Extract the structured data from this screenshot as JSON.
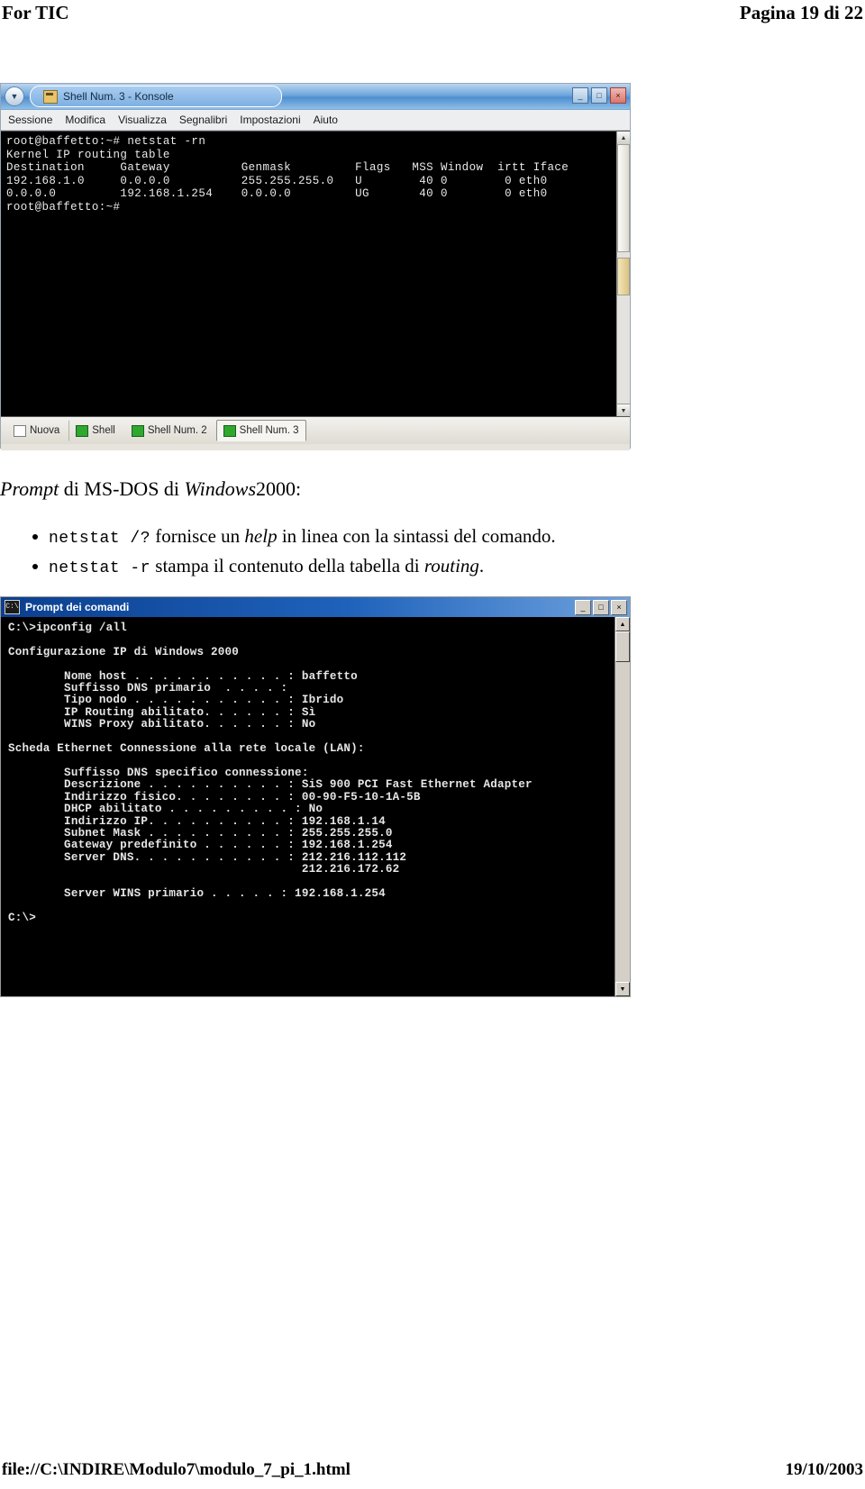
{
  "page": {
    "header_left": "For TIC",
    "header_right": "Pagina 19 di 22",
    "footer_left": "file://C:\\INDIRE\\Modulo7\\modulo_7_pi_1.html",
    "footer_right": "19/10/2003"
  },
  "konsole": {
    "title": "Shell Num. 3 - Konsole",
    "menu": [
      "Sessione",
      "Modifica",
      "Visualizza",
      "Segnalibri",
      "Impostazioni",
      "Aiuto"
    ],
    "window_buttons": [
      "_",
      "□",
      "×"
    ],
    "terminal_text": "root@baffetto:~# netstat -rn\nKernel IP routing table\nDestination     Gateway          Genmask         Flags   MSS Window  irtt Iface\n192.168.1.0     0.0.0.0          255.255.255.0   U        40 0        0 eth0\n0.0.0.0         192.168.1.254    0.0.0.0         UG       40 0        0 eth0\nroot@baffetto:~# ",
    "tabs": [
      {
        "label": "Nuova",
        "icon": "new-document-icon",
        "active": false
      },
      {
        "label": "Shell",
        "icon": "terminal-icon",
        "active": false
      },
      {
        "label": "Shell Num. 2",
        "icon": "terminal-icon",
        "active": false
      },
      {
        "label": "Shell Num. 3",
        "icon": "terminal-icon",
        "active": true
      }
    ]
  },
  "prose": {
    "lead_prompt": "Prompt",
    "lead_mid": " di MS-DOS di ",
    "lead_windows": "Windows",
    "lead_tail": "2000:",
    "bullet1_cmd": "netstat /?",
    "bullet1_a": " fornisce un ",
    "bullet1_help": "help",
    "bullet1_b": " in linea con la sintassi del comando.",
    "bullet2_cmd": "netstat -r",
    "bullet2_a": " stampa il contenuto della tabella di ",
    "bullet2_routing": "routing",
    "bullet2_b": "."
  },
  "cmdprompt": {
    "title": "Prompt dei comandi",
    "window_buttons": [
      "_",
      "□",
      "×"
    ],
    "terminal_text": "C:\\>ipconfig /all\n\nConfigurazione IP di Windows 2000\n\n        Nome host . . . . . . . . . . . : baffetto\n        Suffisso DNS primario  . . . . :\n        Tipo nodo . . . . . . . . . . . : Ibrido\n        IP Routing abilitato. . . . . . : Sì\n        WINS Proxy abilitato. . . . . . : No\n\nScheda Ethernet Connessione alla rete locale (LAN):\n\n        Suffisso DNS specifico connessione:\n        Descrizione . . . . . . . . . . : SiS 900 PCI Fast Ethernet Adapter\n        Indirizzo fisico. . . . . . . . : 00-90-F5-10-1A-5B\n        DHCP abilitato . . . . . . . . . : No\n        Indirizzo IP. . . . . . . . . . : 192.168.1.14\n        Subnet Mask . . . . . . . . . . : 255.255.255.0\n        Gateway predefinito . . . . . . : 192.168.1.254\n        Server DNS. . . . . . . . . . . : 212.216.112.112\n                                          212.216.172.62\n\n        Server WINS primario . . . . . : 192.168.1.254\n\nC:\\>"
  }
}
